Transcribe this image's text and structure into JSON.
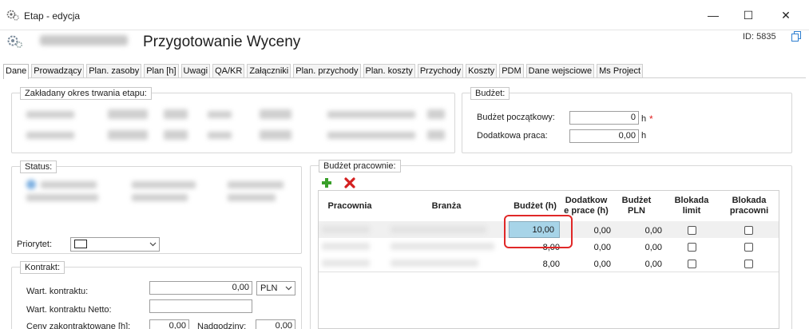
{
  "window": {
    "title": "Etap - edycja",
    "minimize": "—",
    "maximize": "☐",
    "close": "✕"
  },
  "header": {
    "title": "Przygotowanie Wyceny",
    "id_label": "ID: 5835"
  },
  "tabs": [
    "Dane",
    "Prowadzący",
    "Plan. zasoby",
    "Plan [h]",
    "Uwagi",
    "QA/KR",
    "Załączniki",
    "Plan. przychody",
    "Plan. koszty",
    "Przychody",
    "Koszty",
    "PDM",
    "Dane wejsciowe",
    "Ms Project"
  ],
  "groups": {
    "okres": "Zakładany okres trwania etapu:",
    "budzet": "Budżet:",
    "status": "Status:",
    "kontrakt": "Kontrakt:",
    "budzet_pracownie": "Budżet pracownie:"
  },
  "budzet": {
    "poczatkowy_label": "Budżet początkowy:",
    "poczatkowy_value": "0",
    "poczatkowy_unit": "h",
    "required_mark": "*",
    "dodatkowa_label": "Dodatkowa praca:",
    "dodatkowa_value": "0,00",
    "dodatkowa_unit": "h"
  },
  "status": {
    "priorytet_label": "Priorytet:"
  },
  "kontrakt": {
    "wart_label": "Wart. kontraktu:",
    "wart_value": "0,00",
    "currency": "PLN",
    "netto_label": "Wart. kontraktu Netto:",
    "ceny_label": "Ceny zakontraktowane [h]:",
    "ceny_value": "0,00",
    "nadgodziny_label": "Nadgodziny:",
    "nadgodziny_value": "0,00"
  },
  "grid": {
    "columns": [
      "Pracownia",
      "Branża",
      "Budżet (h)",
      "Dodatkowe prace (h)",
      "Budżet PLN",
      "Blokada limit",
      "Blokada pracowni"
    ],
    "col_budzet_h": "Budżet (h)",
    "col_dodatkowe_1": "Dodatkow",
    "col_dodatkowe_2": "e prace (h)",
    "col_budzet_pln_1": "Budżet",
    "col_budzet_pln_2": "PLN",
    "col_blokada_limit_1": "Blokada",
    "col_blokada_limit_2": "limit",
    "col_blokada_prac_1": "Blokada",
    "col_blokada_prac_2": "pracowni",
    "rows": [
      {
        "budzet_h": "10,00",
        "dodatkowe": "0,00",
        "budzet_pln": "0,00"
      },
      {
        "budzet_h": "8,00",
        "dodatkowe": "0,00",
        "budzet_pln": "0,00"
      },
      {
        "budzet_h": "8,00",
        "dodatkowe": "0,00",
        "budzet_pln": "0,00"
      }
    ]
  },
  "colors": {
    "highlight": "#a7d4e8",
    "annotation": "#e02828",
    "add_icon": "#3aa02a",
    "delete_icon": "#d42020"
  }
}
